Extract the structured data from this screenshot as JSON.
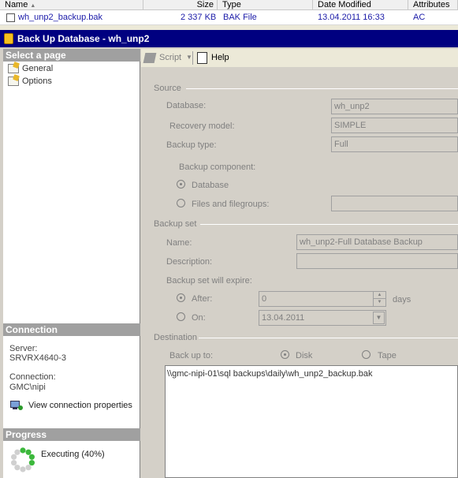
{
  "file_list": {
    "columns": [
      "Name",
      "Size",
      "Type",
      "Date Modified",
      "Attributes"
    ],
    "row": {
      "name": "wh_unp2_backup.bak",
      "size": "2 337 KB",
      "type": "BAK File",
      "date": "13.04.2011 16:33",
      "attributes": "AC"
    }
  },
  "dialog": {
    "title": "Back Up Database - wh_unp2"
  },
  "left": {
    "select_page_header": "Select a page",
    "pages": [
      "General",
      "Options"
    ],
    "connection_header": "Connection",
    "server_label": "Server:",
    "server_value": "SRVRX4640-3",
    "connection_label": "Connection:",
    "connection_value": "GMC\\nipi",
    "view_connection_link": "View connection properties",
    "progress_header": "Progress",
    "progress_status": "Executing (40%)",
    "progress_fraction": 0.4
  },
  "toolbar": {
    "script_label": "Script",
    "help_label": "Help"
  },
  "form": {
    "source_group": "Source",
    "database_label": "Database:",
    "database_value": "wh_unp2",
    "recovery_label": "Recovery model:",
    "recovery_value": "SIMPLE",
    "backup_type_label": "Backup type:",
    "backup_type_value": "Full",
    "backup_component_label": "Backup component:",
    "component_database": "Database",
    "component_files": "Files and filegroups:",
    "backup_set_group": "Backup set",
    "name_label": "Name:",
    "name_value": "wh_unp2-Full Database Backup",
    "description_label": "Description:",
    "description_value": "",
    "expire_label": "Backup set will expire:",
    "after_label": "After:",
    "after_value": "0",
    "days_label": "days",
    "on_label": "On:",
    "on_value": "13.04.2011",
    "destination_group": "Destination",
    "back_up_to_label": "Back up to:",
    "disk_label": "Disk",
    "tape_label": "Tape",
    "destination_path": "\\\\gmc-nipi-01\\sql backups\\daily\\wh_unp2_backup.bak"
  },
  "colors": {
    "title_bar": "#000080",
    "pane_header": "#a0a0a0",
    "link": "#1a1aa8"
  }
}
